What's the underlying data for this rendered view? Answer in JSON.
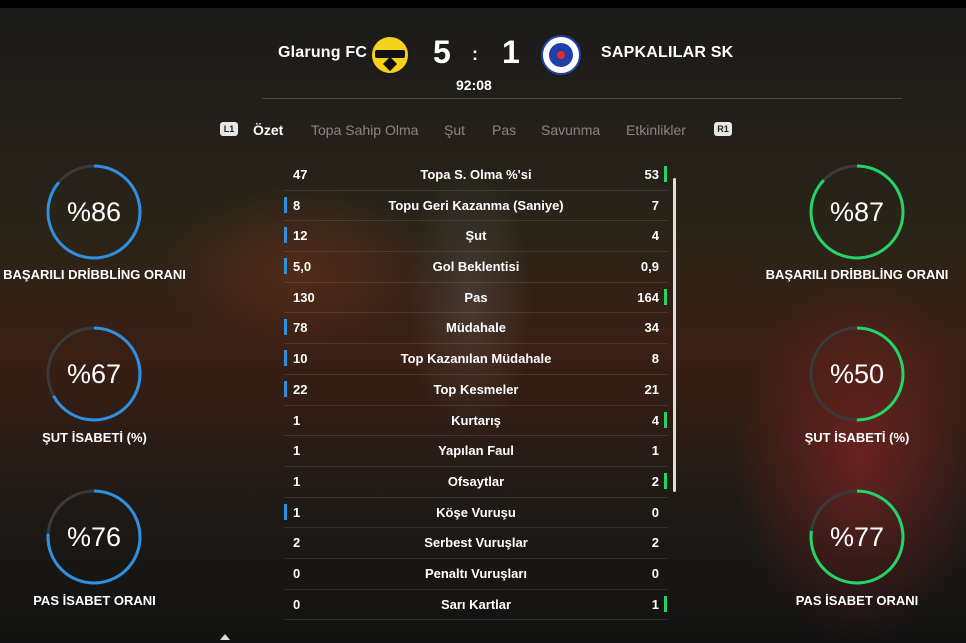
{
  "match": {
    "home": {
      "name": "Glarung FC",
      "score": "5",
      "crest_text": "PHOENIX"
    },
    "away": {
      "name": "SAPKALILAR SK",
      "score": "1"
    },
    "separator": ":",
    "clock": "92:08"
  },
  "nav": {
    "left_bumper": "L1",
    "right_bumper": "R1",
    "tabs": [
      "Özet",
      "Topa Sahip Olma",
      "Şut",
      "Pas",
      "Savunma",
      "Etkinlikler"
    ],
    "active_tab": "Özet"
  },
  "gauges": {
    "home": [
      {
        "value": "%86",
        "pct": 86,
        "label": "BAŞARILI DRİBBLİNG ORANI"
      },
      {
        "value": "%67",
        "pct": 67,
        "label": "ŞUT İSABETİ (%)"
      },
      {
        "value": "%76",
        "pct": 76,
        "label": "PAS İSABET ORANI"
      }
    ],
    "away": [
      {
        "value": "%87",
        "pct": 87,
        "label": "BAŞARILI DRİBBLİNG ORANI"
      },
      {
        "value": "%50",
        "pct": 50,
        "label": "ŞUT İSABETİ (%)"
      },
      {
        "value": "%77",
        "pct": 77,
        "label": "PAS İSABET ORANI"
      }
    ]
  },
  "stats": [
    {
      "name": "Topa S. Olma %'si",
      "home": "47",
      "away": "53",
      "leader": "away"
    },
    {
      "name": "Topu Geri Kazanma (Saniye)",
      "home": "8",
      "away": "7",
      "leader": "home"
    },
    {
      "name": "Şut",
      "home": "12",
      "away": "4",
      "leader": "home"
    },
    {
      "name": "Gol Beklentisi",
      "home": "5,0",
      "away": "0,9",
      "leader": "home"
    },
    {
      "name": "Pas",
      "home": "130",
      "away": "164",
      "leader": "away"
    },
    {
      "name": "Müdahale",
      "home": "78",
      "away": "34",
      "leader": "home"
    },
    {
      "name": "Top Kazanılan Müdahale",
      "home": "10",
      "away": "8",
      "leader": "home"
    },
    {
      "name": "Top Kesmeler",
      "home": "22",
      "away": "21",
      "leader": "home"
    },
    {
      "name": "Kurtarış",
      "home": "1",
      "away": "4",
      "leader": "away"
    },
    {
      "name": "Yapılan Faul",
      "home": "1",
      "away": "1",
      "leader": "none"
    },
    {
      "name": "Ofsaytlar",
      "home": "1",
      "away": "2",
      "leader": "away"
    },
    {
      "name": "Köşe Vuruşu",
      "home": "1",
      "away": "0",
      "leader": "home"
    },
    {
      "name": "Serbest Vuruşlar",
      "home": "2",
      "away": "2",
      "leader": "none"
    },
    {
      "name": "Penaltı Vuruşları",
      "home": "0",
      "away": "0",
      "leader": "none"
    },
    {
      "name": "Sarı Kartlar",
      "home": "0",
      "away": "1",
      "leader": "away"
    }
  ],
  "colors": {
    "home_accent": "#2f8fe0",
    "away_accent": "#25d366",
    "track": "#3a3a3a"
  }
}
